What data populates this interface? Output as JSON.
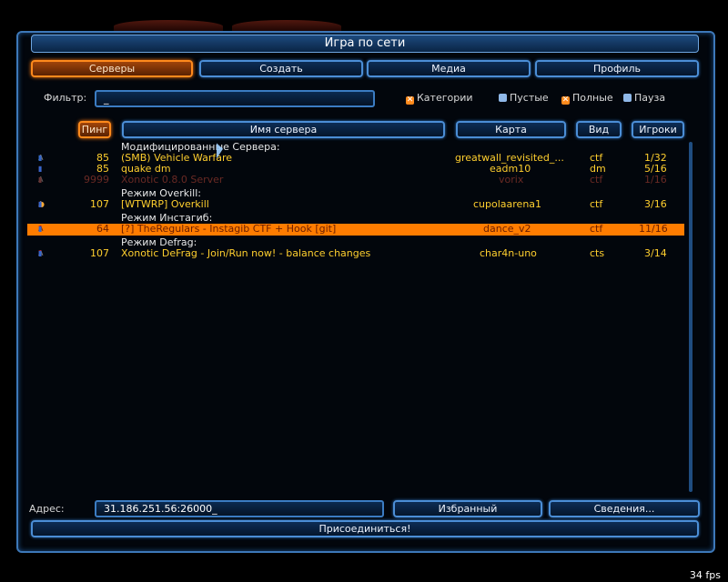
{
  "window": {
    "title": "Игра по сети"
  },
  "tabs": [
    {
      "label": "Серверы",
      "selected": true
    },
    {
      "label": "Создать",
      "selected": false
    },
    {
      "label": "Медиа",
      "selected": false
    },
    {
      "label": "Профиль",
      "selected": false
    }
  ],
  "filter": {
    "label": "Фильтр:",
    "value": "_"
  },
  "checkboxes": [
    {
      "label": "Категории",
      "checked": true
    },
    {
      "label": "Пустые",
      "checked": false
    },
    {
      "label": "Полные",
      "checked": true
    },
    {
      "label": "Пауза",
      "checked": false
    }
  ],
  "columns": {
    "ping": "Пинг",
    "name": "Имя сервера",
    "map": "Карта",
    "type": "Вид",
    "players": "Игроки"
  },
  "rows": [
    {
      "kind": "category",
      "name": "Модифицированные Сервера:"
    },
    {
      "kind": "server",
      "ping": "85",
      "name": "(SMB) Vehicle Warfare",
      "map": "greatwall_revisited_...",
      "type": "ctf",
      "players": "1/32",
      "style": "yellow"
    },
    {
      "kind": "server",
      "ping": "85",
      "name": "quake dm",
      "map": "eadm10",
      "type": "dm",
      "players": "5/16",
      "style": "yellow"
    },
    {
      "kind": "server",
      "ping": "9999",
      "name": "Xonotic 0.8.0 Server",
      "map": "vorix",
      "type": "ctf",
      "players": "1/16",
      "style": "dim"
    },
    {
      "kind": "category",
      "name": "Режим Overkill:"
    },
    {
      "kind": "server",
      "ping": "107",
      "name": "[WTWRP] Overkill",
      "map": "cupolaarena1",
      "type": "ctf",
      "players": "3/16",
      "style": "yellow"
    },
    {
      "kind": "category",
      "name": "Режим Инстагиб:"
    },
    {
      "kind": "server",
      "ping": "64",
      "name": "[?] TheRegulars - Instagib CTF + Hook [git]",
      "map": "dance_v2",
      "type": "ctf",
      "players": "11/16",
      "style": "highlight"
    },
    {
      "kind": "category",
      "name": "Режим Defrag:"
    },
    {
      "kind": "server",
      "ping": "107",
      "name": "Xonotic DeFrag - Join/Run now! - balance changes",
      "map": "char4n-uno",
      "type": "cts",
      "players": "3/14",
      "style": "yellow"
    }
  ],
  "address": {
    "label": "Адрес:",
    "value": "31.186.251.56:26000_"
  },
  "buttons": {
    "favorite": "Избранный",
    "info": "Сведения...",
    "join": "Присоединиться!"
  },
  "status": {
    "fps": "34 fps"
  },
  "colors": {
    "accent": "#ff8a1c",
    "frame": "#3d78b8",
    "server_text": "#ffcf2e"
  }
}
